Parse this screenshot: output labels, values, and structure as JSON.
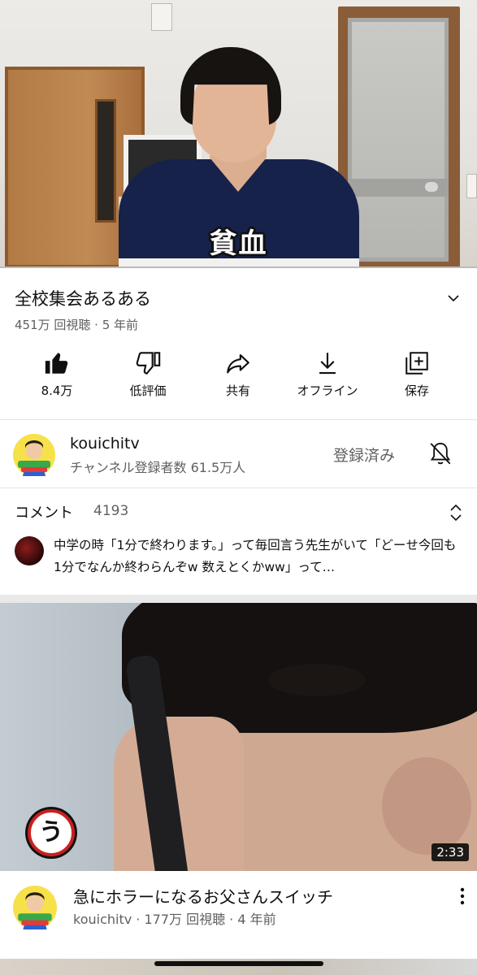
{
  "player": {
    "caption": "貧血",
    "progress": 0.0
  },
  "video": {
    "title": "全校集会あるある",
    "meta": "451万 回視聴 · 5 年前"
  },
  "actions": [
    {
      "label": "8.4万",
      "icon": "thumbs-up-icon"
    },
    {
      "label": "低評価",
      "icon": "thumbs-down-icon"
    },
    {
      "label": "共有",
      "icon": "share-icon"
    },
    {
      "label": "オフライン",
      "icon": "download-icon"
    },
    {
      "label": "保存",
      "icon": "add-to-playlist-icon"
    }
  ],
  "channel": {
    "name": "kouichitv",
    "subscribers": "チャンネル登録者数 61.5万人",
    "subscribed_label": "登録済み"
  },
  "comments": {
    "header": "コメント",
    "count": "4193",
    "top_comment": "中学の時「1分で終わります。」って毎回言う先生がいて「どーせ今回も1分でなんか終わらんぞw 数えとくかww」って…"
  },
  "next_video": {
    "badge": "う",
    "duration": "2:33",
    "title": "急にホラーになるお父さんスイッチ",
    "meta": "kouichitv · 177万 回視聴 · 4 年前"
  },
  "colors": {
    "text_primary": "#0f0f0f",
    "text_secondary": "#606060",
    "divider": "#e5e5e5"
  }
}
